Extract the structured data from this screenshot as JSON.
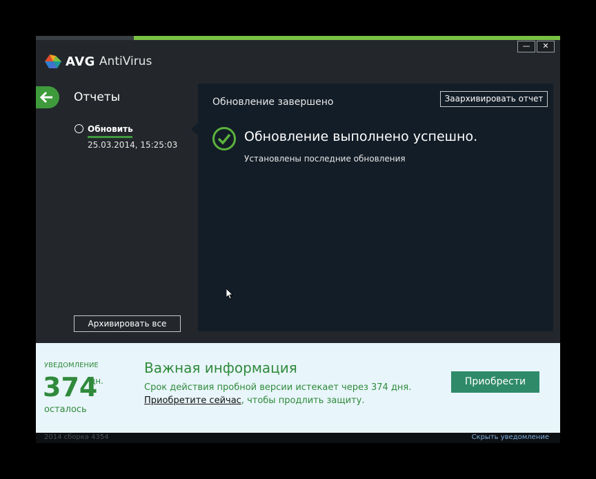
{
  "window": {
    "brand": "AVG",
    "product": "AntiVirus",
    "minimize_label": "—",
    "close_label": "✕",
    "progress_fraction": 0.81
  },
  "sidebar": {
    "title": "Отчеты",
    "report": {
      "name": "Обновить",
      "date": "25.03.2014, 15:25:03"
    },
    "archive_all_label": "Архивировать все"
  },
  "report_panel": {
    "title": "Обновление завершено",
    "archive_report_label": "Заархивировать отчет",
    "headline": "Обновление выполнено успешно.",
    "subtext": "Установлены последние обновления"
  },
  "notification": {
    "label": "УВЕДОМЛЕНИЕ",
    "days_value": "374",
    "days_unit": "дн.",
    "remaining_label": "осталось",
    "heading": "Важная информация",
    "line1": "Срок действия пробной версии истекает через 374 дня.",
    "line2_link": "Приобретите сейчас",
    "line2_rest": ", чтобы продлить защиту.",
    "buy_label": "Приобрести"
  },
  "footer": {
    "version": "2014   сборка 4354",
    "hide_label": "Скрыть уведомление"
  },
  "colors": {
    "accent_green": "#3f9a3c",
    "panel_bg": "#131d27",
    "window_bg": "#23272b",
    "notify_bg": "#e8f5fa",
    "buy_button": "#2f8a69"
  }
}
